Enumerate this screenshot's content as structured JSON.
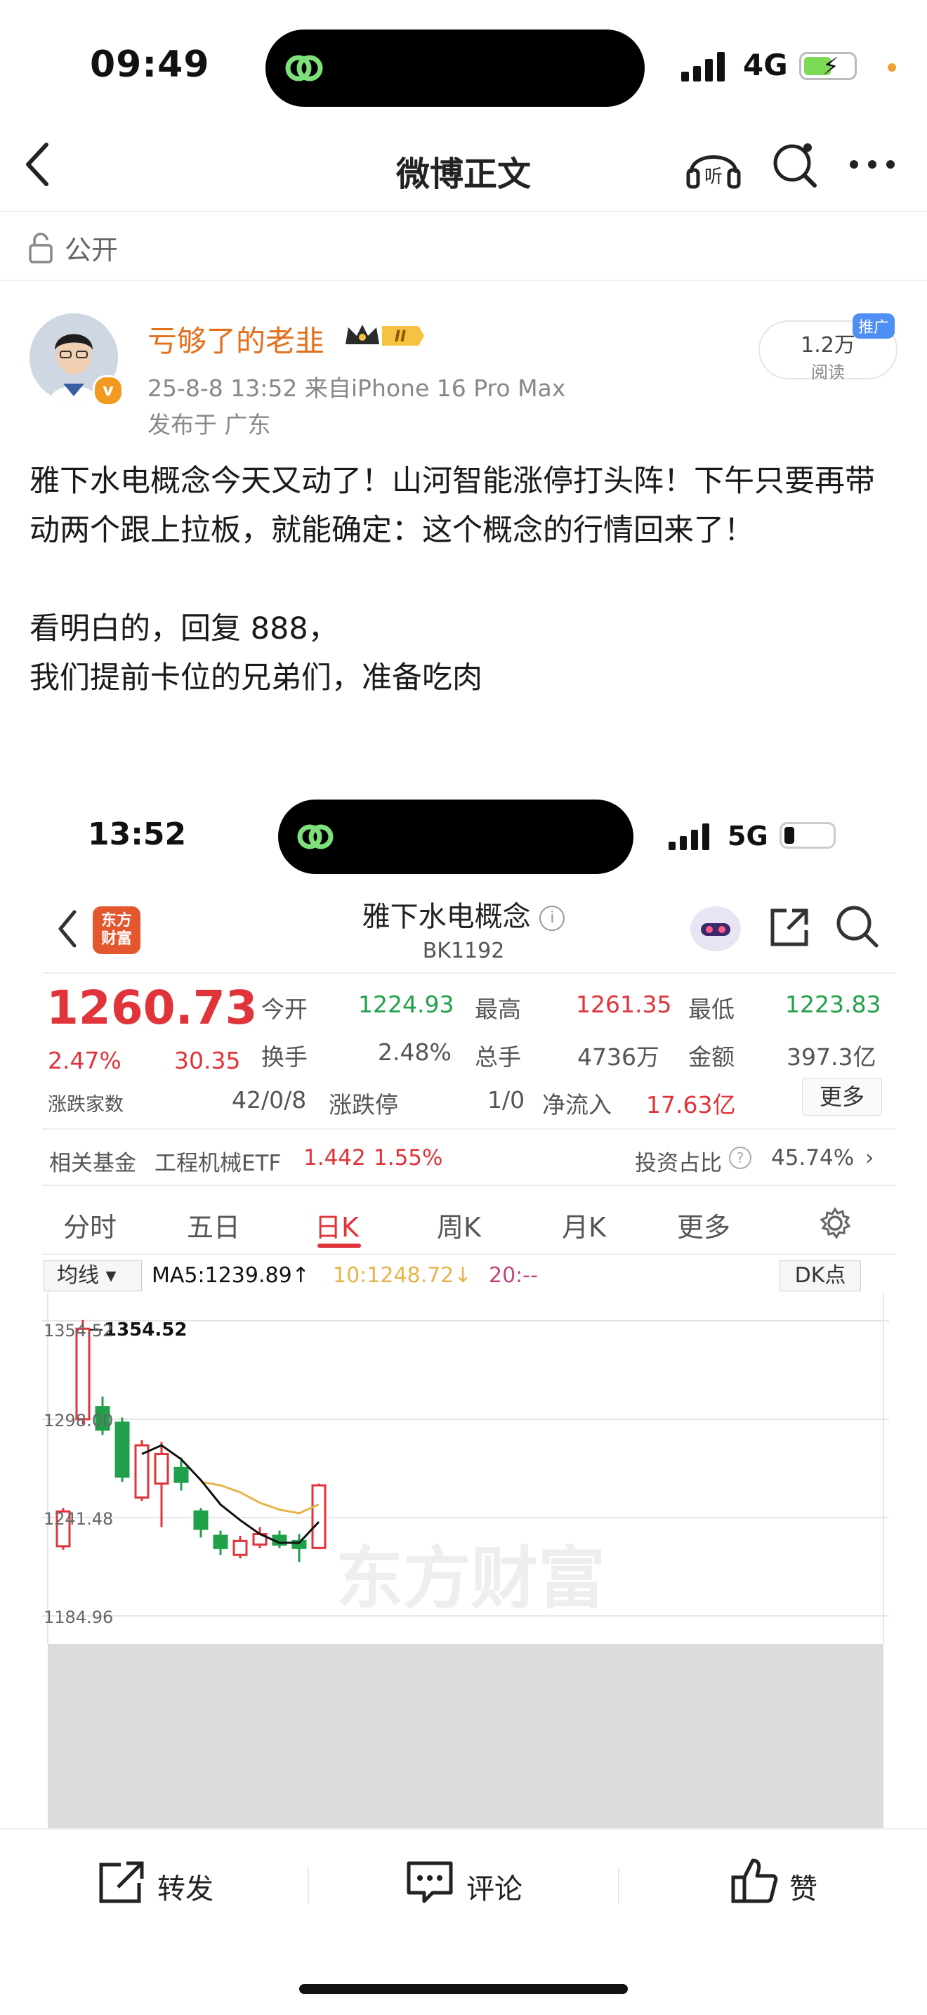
{
  "status_bar": {
    "time": "09:49",
    "network": "4G"
  },
  "nav": {
    "title": "微博正文",
    "listen_icon": "headphones-icon",
    "search_icon": "search-icon",
    "more_icon": "more-icon"
  },
  "visibility": {
    "label": "公开"
  },
  "author": {
    "name": "亏够了的老韭",
    "level_badge": "II",
    "verified_mark": "v",
    "meta": "25-8-8 13:52  来自iPhone 16 Pro Max",
    "location": "发布于 广东"
  },
  "read_badge": {
    "count": "1.2万",
    "label": "阅读",
    "promo": "推广"
  },
  "post": {
    "lines": [
      "雅下水电概念今天又动了！山河智能涨停打头阵！下午只要再带动两个跟上拉板，就能确定：这个概念的行情回来了！",
      "",
      "看明白的，回复 888，",
      "我们提前卡位的兄弟们，准备吃肉"
    ]
  },
  "screenshot": {
    "status": {
      "time": "13:52",
      "network": "5G"
    },
    "app_logo": "东方\n财富",
    "title": "雅下水电概念",
    "code": "BK1192",
    "price": "1260.73",
    "change_pct": "2.47%",
    "change_abs": "30.35",
    "quote": {
      "open_label": "今开",
      "open": "1224.93",
      "high_label": "最高",
      "high": "1261.35",
      "low_label": "最低",
      "low": "1223.83",
      "turnover_label": "换手",
      "turnover": "2.48%",
      "volume_label": "总手",
      "volume": "4736万",
      "amount_label": "金额",
      "amount": "397.3亿",
      "updown_label": "涨跌家数",
      "updown": "42/0/8",
      "limit_label": "涨跌停",
      "limit": "1/0",
      "inflow_label": "净流入",
      "inflow": "17.63亿",
      "more": "更多"
    },
    "fund": {
      "label": "相关基金",
      "name": "工程机械ETF",
      "price": "1.442",
      "pct": "1.55%",
      "ratio_label": "投资占比",
      "ratio": "45.74%"
    },
    "tabs": [
      "分时",
      "五日",
      "日K",
      "周K",
      "月K",
      "更多"
    ],
    "active_tab": "日K",
    "chart_header": {
      "select": "均线",
      "ma5": "MA5:1239.89↑",
      "ma10": "10:1248.72↓",
      "ma20": "20:--",
      "dk": "DK点"
    },
    "watermark": "东方财富",
    "colors": {
      "up": "#e0343a",
      "down": "#21a04a",
      "ma5": "#111111",
      "ma10": "#e6b54a"
    }
  },
  "chart_data": {
    "type": "candlestick",
    "title": "",
    "y_tick_labels": [
      "1354.52",
      "1298.00",
      "1241.48",
      "1184.96"
    ],
    "max_annotation": "1354.52",
    "candles": [
      {
        "open": 1225,
        "close": 1245,
        "high": 1247,
        "low": 1223
      },
      {
        "open": 1298,
        "close": 1350,
        "high": 1355,
        "low": 1295
      },
      {
        "open": 1305,
        "close": 1292,
        "high": 1311,
        "low": 1289
      },
      {
        "open": 1296,
        "close": 1265,
        "high": 1299,
        "low": 1262
      },
      {
        "open": 1253,
        "close": 1283,
        "high": 1286,
        "low": 1251
      },
      {
        "open": 1261,
        "close": 1278,
        "high": 1285,
        "low": 1236
      },
      {
        "open": 1270,
        "close": 1262,
        "high": 1276,
        "low": 1257
      },
      {
        "open": 1245,
        "close": 1235,
        "high": 1247,
        "low": 1230
      },
      {
        "open": 1231,
        "close": 1224,
        "high": 1234,
        "low": 1220
      },
      {
        "open": 1220,
        "close": 1228,
        "high": 1231,
        "low": 1218
      },
      {
        "open": 1226,
        "close": 1232,
        "high": 1236,
        "low": 1224
      },
      {
        "open": 1231,
        "close": 1226,
        "high": 1234,
        "low": 1224
      },
      {
        "open": 1228,
        "close": 1224,
        "high": 1232,
        "low": 1216
      },
      {
        "open": 1224,
        "close": 1260,
        "high": 1261,
        "low": 1224
      }
    ],
    "ma5": [
      null,
      null,
      null,
      null,
      1278,
      1283,
      1275,
      1263,
      1249,
      1240,
      1232,
      1227,
      1227,
      1239
    ],
    "ma10": [
      null,
      null,
      null,
      null,
      null,
      null,
      null,
      1262,
      1260,
      1256,
      1250,
      1246,
      1244,
      1249
    ]
  },
  "bottom_bar": {
    "repost": "转发",
    "comment": "评论",
    "like": "赞"
  }
}
